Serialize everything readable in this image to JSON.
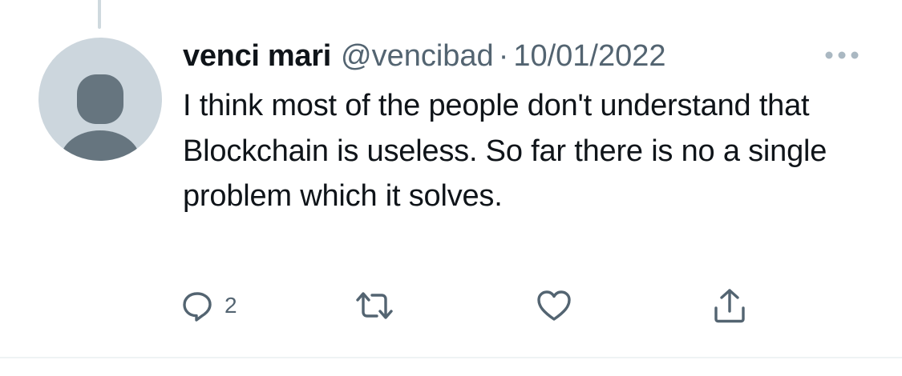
{
  "tweet": {
    "display_name": "venci mari",
    "handle": "@vencibad",
    "separator": "·",
    "date": "10/01/2022",
    "text": "I think most of the people don't understand that Blockchain is useless. So far there is no a single problem which it solves."
  },
  "actions": {
    "reply": {
      "icon": "reply-icon",
      "count": "2"
    },
    "retweet": {
      "icon": "retweet-icon"
    },
    "like": {
      "icon": "heart-icon"
    },
    "share": {
      "icon": "share-icon"
    }
  },
  "colors": {
    "text_primary": "#0f1419",
    "text_secondary": "#536471",
    "avatar_bg": "#ccd6dd",
    "avatar_figure": "#66757f",
    "divider": "#eff3f4"
  }
}
